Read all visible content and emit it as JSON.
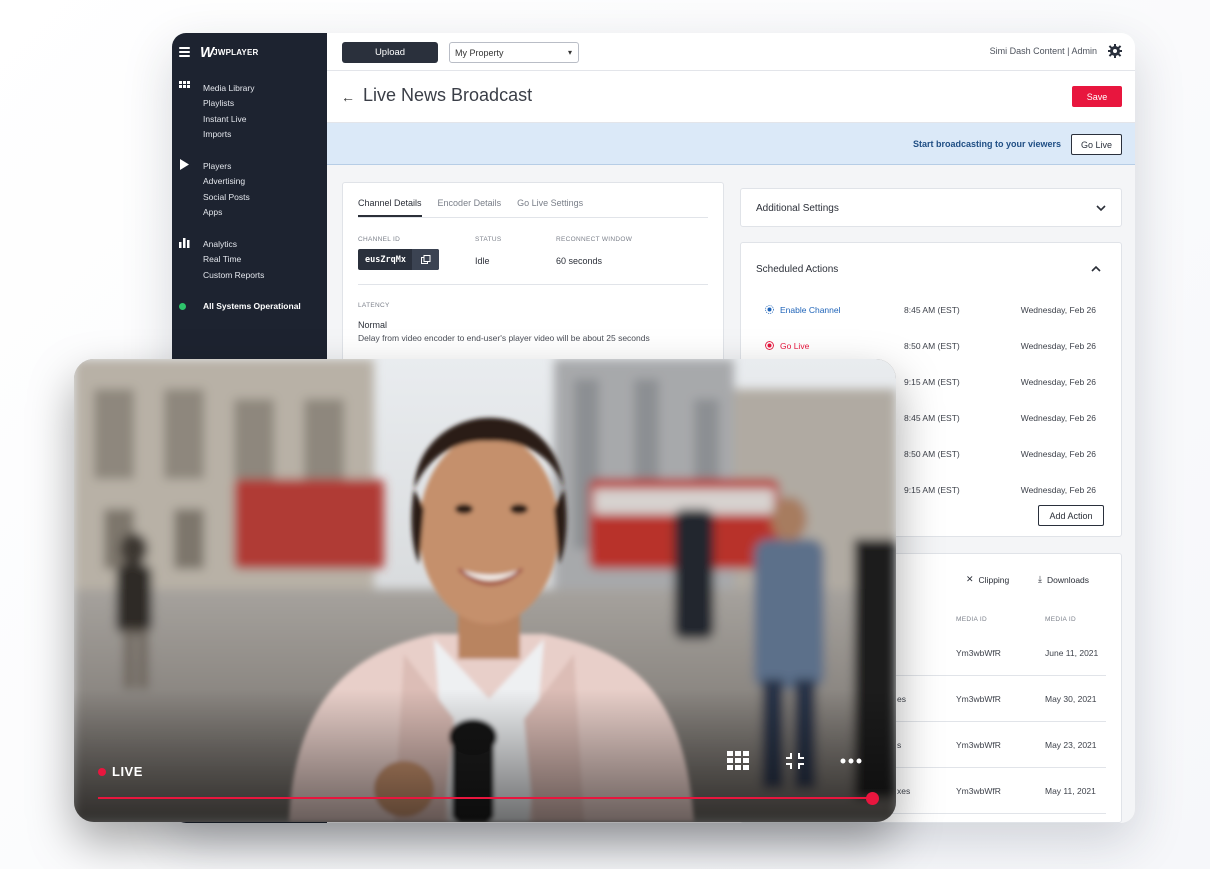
{
  "sidebar": {
    "logo_mark": "W",
    "logo_word": "JWPLAYER",
    "groups": [
      {
        "icon": "grid-icon",
        "items": [
          "Media Library",
          "Playlists",
          "Instant Live",
          "Imports"
        ]
      },
      {
        "icon": "play-icon",
        "items": [
          "Players",
          "Advertising",
          "Social Posts",
          "Apps"
        ]
      },
      {
        "icon": "bar-chart-icon",
        "items": [
          "Analytics",
          "Real Time",
          "Custom Reports"
        ]
      }
    ],
    "status": "All Systems Operational",
    "status_color": "#2ec46b"
  },
  "topbar": {
    "upload_label": "Upload",
    "property_value": "My Property",
    "org_label": "Simi Dash Content | Admin"
  },
  "header": {
    "title": "Live News Broadcast",
    "save_label": "Save"
  },
  "banner": {
    "text": "Start broadcasting to your viewers",
    "button_label": "Go Live"
  },
  "channel_card": {
    "tabs": [
      "Channel Details",
      "Encoder Details",
      "Go Live Settings"
    ],
    "channel_id_label": "CHANNEL ID",
    "channel_id": "eusZrqMx",
    "status_label": "STATUS",
    "status": "Idle",
    "reconnect_label": "RECONNECT WINDOW",
    "reconnect": "60 seconds",
    "latency_label": "LATENCY",
    "latency": "Normal",
    "latency_desc": "Delay from video encoder to end-user's player video will be about 25 seconds"
  },
  "additional_settings": {
    "title": "Additional Settings"
  },
  "scheduled_actions": {
    "title": "Scheduled Actions",
    "rows": [
      {
        "name": "Enable Channel",
        "time": "8:45 AM (EST)",
        "date": "Wednesday, Feb 26"
      },
      {
        "name": "Go Live",
        "time": "8:50 AM (EST)",
        "date": "Wednesday, Feb 26"
      },
      {
        "name": "",
        "time": "9:15 AM (EST)",
        "date": "Wednesday, Feb 26"
      },
      {
        "name": "",
        "time": "8:45 AM (EST)",
        "date": "Wednesday, Feb 26"
      },
      {
        "name": "",
        "time": "8:50 AM (EST)",
        "date": "Wednesday, Feb 26"
      },
      {
        "name": "",
        "time": "9:15 AM (EST)",
        "date": "Wednesday, Feb 26"
      }
    ],
    "add_label": "Add Action",
    "colors": {
      "enable": "#1e63b8",
      "golive": "#e8163e"
    }
  },
  "media_card": {
    "clipping_label": "Clipping",
    "downloads_label": "Downloads",
    "col_media_id": "MEDIA ID",
    "col_media_id_2": "MEDIA ID",
    "rows": [
      {
        "tail": "",
        "media_id": "Ym3wbWfR",
        "date": "June 11, 2021"
      },
      {
        "tail": "es",
        "media_id": "Ym3wbWfR",
        "date": "May 30, 2021"
      },
      {
        "tail": "s",
        "media_id": "Ym3wbWfR",
        "date": "May 23, 2021"
      },
      {
        "tail": "xes",
        "media_id": "Ym3wbWfR",
        "date": "May 11, 2021"
      }
    ]
  },
  "video": {
    "live_label": "LIVE",
    "progress": 1.0,
    "accent": "#e8163e"
  }
}
